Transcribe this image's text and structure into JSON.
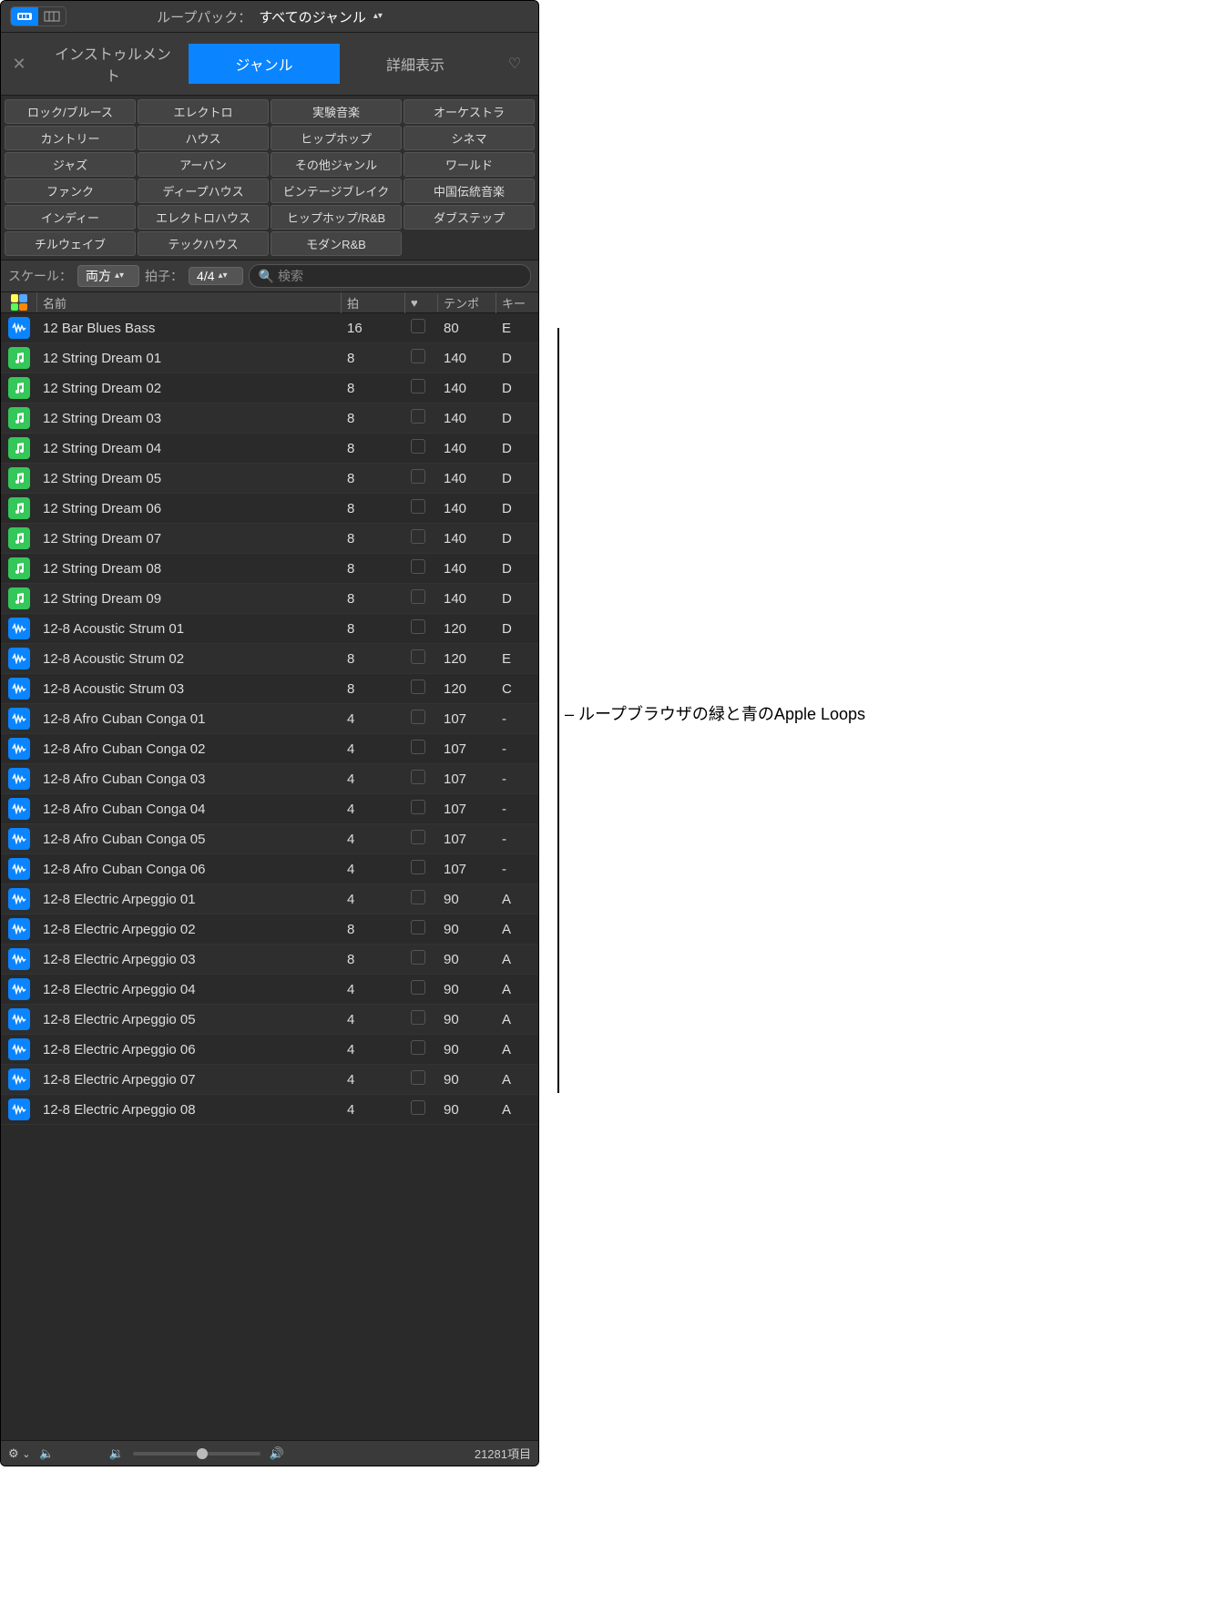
{
  "topbar": {
    "loop_pack_label": "ループパック：",
    "loop_pack_value": "すべてのジャンル"
  },
  "tabs": {
    "instrument": "インストゥルメント",
    "genre": "ジャンル",
    "detail": "詳細表示"
  },
  "genres": [
    "ロック/ブルース",
    "エレクトロ",
    "実験音楽",
    "オーケストラ",
    "カントリー",
    "ハウス",
    "ヒップホップ",
    "シネマ",
    "ジャズ",
    "アーバン",
    "その他ジャンル",
    "ワールド",
    "ファンク",
    "ディープハウス",
    "ビンテージブレイク",
    "中国伝統音楽",
    "インディー",
    "エレクトロハウス",
    "ヒップホップ/R&B",
    "ダブステップ",
    "チルウェイブ",
    "テックハウス",
    "モダンR&B",
    ""
  ],
  "scale": {
    "label": "スケール：",
    "value": "両方",
    "beat_label": "拍子：",
    "beat_value": "4/4",
    "search_placeholder": "検索"
  },
  "columns": {
    "name": "名前",
    "beats": "拍",
    "tempo": "テンポ",
    "key": "キー"
  },
  "loops": [
    {
      "type": "audio",
      "name": "12 Bar Blues Bass",
      "beats": "16",
      "tempo": "80",
      "key": "E"
    },
    {
      "type": "midi",
      "name": "12 String Dream 01",
      "beats": "8",
      "tempo": "140",
      "key": "D"
    },
    {
      "type": "midi",
      "name": "12 String Dream 02",
      "beats": "8",
      "tempo": "140",
      "key": "D"
    },
    {
      "type": "midi",
      "name": "12 String Dream 03",
      "beats": "8",
      "tempo": "140",
      "key": "D"
    },
    {
      "type": "midi",
      "name": "12 String Dream 04",
      "beats": "8",
      "tempo": "140",
      "key": "D"
    },
    {
      "type": "midi",
      "name": "12 String Dream 05",
      "beats": "8",
      "tempo": "140",
      "key": "D"
    },
    {
      "type": "midi",
      "name": "12 String Dream 06",
      "beats": "8",
      "tempo": "140",
      "key": "D"
    },
    {
      "type": "midi",
      "name": "12 String Dream 07",
      "beats": "8",
      "tempo": "140",
      "key": "D"
    },
    {
      "type": "midi",
      "name": "12 String Dream 08",
      "beats": "8",
      "tempo": "140",
      "key": "D"
    },
    {
      "type": "midi",
      "name": "12 String Dream 09",
      "beats": "8",
      "tempo": "140",
      "key": "D"
    },
    {
      "type": "audio",
      "name": "12-8 Acoustic Strum 01",
      "beats": "8",
      "tempo": "120",
      "key": "D"
    },
    {
      "type": "audio",
      "name": "12-8 Acoustic Strum 02",
      "beats": "8",
      "tempo": "120",
      "key": "E"
    },
    {
      "type": "audio",
      "name": "12-8 Acoustic Strum 03",
      "beats": "8",
      "tempo": "120",
      "key": "C"
    },
    {
      "type": "audio",
      "name": "12-8 Afro Cuban Conga 01",
      "beats": "4",
      "tempo": "107",
      "key": "-"
    },
    {
      "type": "audio",
      "name": "12-8 Afro Cuban Conga 02",
      "beats": "4",
      "tempo": "107",
      "key": "-"
    },
    {
      "type": "audio",
      "name": "12-8 Afro Cuban Conga 03",
      "beats": "4",
      "tempo": "107",
      "key": "-"
    },
    {
      "type": "audio",
      "name": "12-8 Afro Cuban Conga 04",
      "beats": "4",
      "tempo": "107",
      "key": "-"
    },
    {
      "type": "audio",
      "name": "12-8 Afro Cuban Conga 05",
      "beats": "4",
      "tempo": "107",
      "key": "-"
    },
    {
      "type": "audio",
      "name": "12-8 Afro Cuban Conga 06",
      "beats": "4",
      "tempo": "107",
      "key": "-"
    },
    {
      "type": "audio",
      "name": "12-8 Electric Arpeggio 01",
      "beats": "4",
      "tempo": "90",
      "key": "A"
    },
    {
      "type": "audio",
      "name": "12-8 Electric Arpeggio 02",
      "beats": "8",
      "tempo": "90",
      "key": "A"
    },
    {
      "type": "audio",
      "name": "12-8 Electric Arpeggio 03",
      "beats": "8",
      "tempo": "90",
      "key": "A"
    },
    {
      "type": "audio",
      "name": "12-8 Electric Arpeggio 04",
      "beats": "4",
      "tempo": "90",
      "key": "A"
    },
    {
      "type": "audio",
      "name": "12-8 Electric Arpeggio 05",
      "beats": "4",
      "tempo": "90",
      "key": "A"
    },
    {
      "type": "audio",
      "name": "12-8 Electric Arpeggio 06",
      "beats": "4",
      "tempo": "90",
      "key": "A"
    },
    {
      "type": "audio",
      "name": "12-8 Electric Arpeggio 07",
      "beats": "4",
      "tempo": "90",
      "key": "A"
    },
    {
      "type": "audio",
      "name": "12-8 Electric Arpeggio 08",
      "beats": "4",
      "tempo": "90",
      "key": "A"
    }
  ],
  "footer": {
    "items_count": "21281項目"
  },
  "callout": {
    "text": "ループブラウザの緑と青のApple Loops"
  }
}
